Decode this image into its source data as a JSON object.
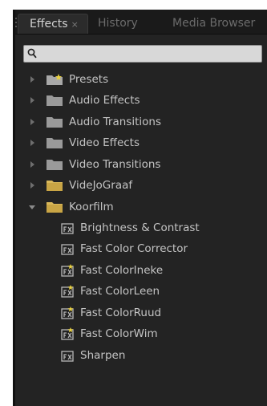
{
  "tabs": [
    {
      "label": "Effects",
      "close": "×",
      "active": true
    },
    {
      "label": "History",
      "active": false
    },
    {
      "label": "Media Browser",
      "active": false
    }
  ],
  "search": {
    "value": "",
    "placeholder": ""
  },
  "tree": {
    "folders": [
      {
        "label": "Presets",
        "icon": "preset-folder-icon",
        "expanded": false
      },
      {
        "label": "Audio Effects",
        "icon": "folder-icon",
        "expanded": false
      },
      {
        "label": "Audio Transitions",
        "icon": "folder-icon",
        "expanded": false
      },
      {
        "label": "Video Effects",
        "icon": "folder-icon",
        "expanded": false
      },
      {
        "label": "Video Transitions",
        "icon": "folder-icon",
        "expanded": false
      },
      {
        "label": "VideJoGraaf",
        "icon": "custom-bin-icon",
        "expanded": false
      },
      {
        "label": "Koorfilm",
        "icon": "custom-bin-icon",
        "expanded": true
      }
    ],
    "effects": [
      {
        "label": "Brightness & Contrast",
        "icon": "effect-icon"
      },
      {
        "label": "Fast Color Corrector",
        "icon": "effect-icon"
      },
      {
        "label": "Fast ColorIneke",
        "icon": "preset-effect-icon"
      },
      {
        "label": "Fast ColorLeen",
        "icon": "preset-effect-icon"
      },
      {
        "label": "Fast ColorRuud",
        "icon": "preset-effect-icon"
      },
      {
        "label": "Fast ColorWim",
        "icon": "preset-effect-icon"
      },
      {
        "label": "Sharpen",
        "icon": "effect-icon"
      }
    ]
  },
  "colors": {
    "panel_bg": "#232323",
    "text": "#c4c4c4",
    "gray_folder": "#9a9a9a",
    "custom_bin": "#d9b85a",
    "preset_star": "#e8d040"
  }
}
